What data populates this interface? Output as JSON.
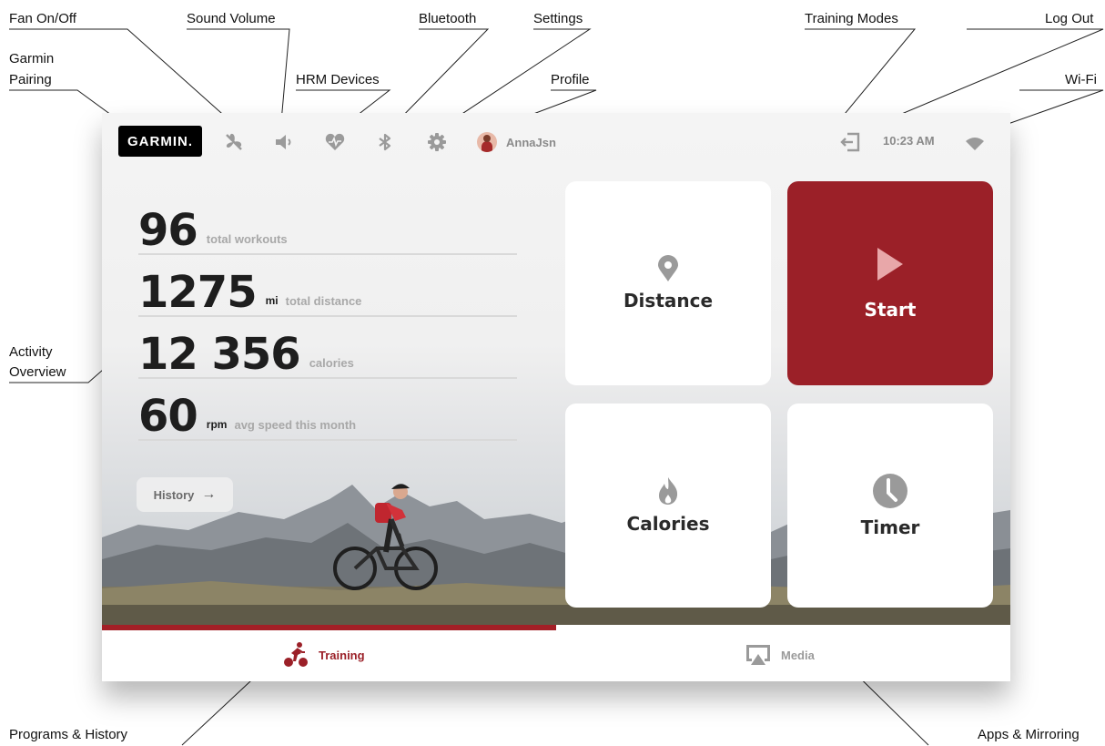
{
  "callouts": {
    "fan": "Fan On/Off",
    "garmin_line1": "Garmin",
    "garmin_line2": "Pairing",
    "sound": "Sound Volume",
    "hrm": "HRM Devices",
    "bluetooth": "Bluetooth",
    "settings": "Settings",
    "profile": "Profile",
    "training_modes": "Training Modes",
    "logout": "Log Out",
    "wifi": "Wi-Fi",
    "activity_line1": "Activity",
    "activity_line2": "Overview",
    "programs": "Programs & History",
    "apps": "Apps & Mirroring"
  },
  "topbar": {
    "logo": "GARMIN.",
    "profile_name": "AnnaJsn",
    "time": "10:23 AM",
    "icons": [
      "fan-off-icon",
      "speaker-icon",
      "heart-rate-icon",
      "bluetooth-icon",
      "gear-icon",
      "logout-icon",
      "wifi-icon"
    ]
  },
  "stats": [
    {
      "value": "96",
      "unit": "",
      "label": "total workouts"
    },
    {
      "value": "1275",
      "unit": "mi",
      "label": "total distance"
    },
    {
      "value": "12 356",
      "unit": "",
      "label": "calories"
    },
    {
      "value": "60",
      "unit": "rpm",
      "label": "avg speed this month"
    }
  ],
  "history_button": {
    "label": "History",
    "icon": "arrow-right-icon"
  },
  "tiles": {
    "distance": {
      "label": "Distance",
      "icon": "map-pin-icon"
    },
    "start": {
      "label": "Start",
      "icon": "play-icon"
    },
    "calories": {
      "label": "Calories",
      "icon": "flame-icon"
    },
    "timer": {
      "label": "Timer",
      "icon": "clock-icon"
    }
  },
  "bottom_nav": {
    "training": {
      "label": "Training",
      "icon": "cyclist-icon",
      "active": true
    },
    "media": {
      "label": "Media",
      "icon": "screen-mirror-icon",
      "active": false
    },
    "progress": 0.5
  },
  "colors": {
    "accent": "#9b2028",
    "icon_gray": "#9a9a9a",
    "text_dark": "#1e1e1e",
    "text_muted": "#a8a8a8"
  }
}
